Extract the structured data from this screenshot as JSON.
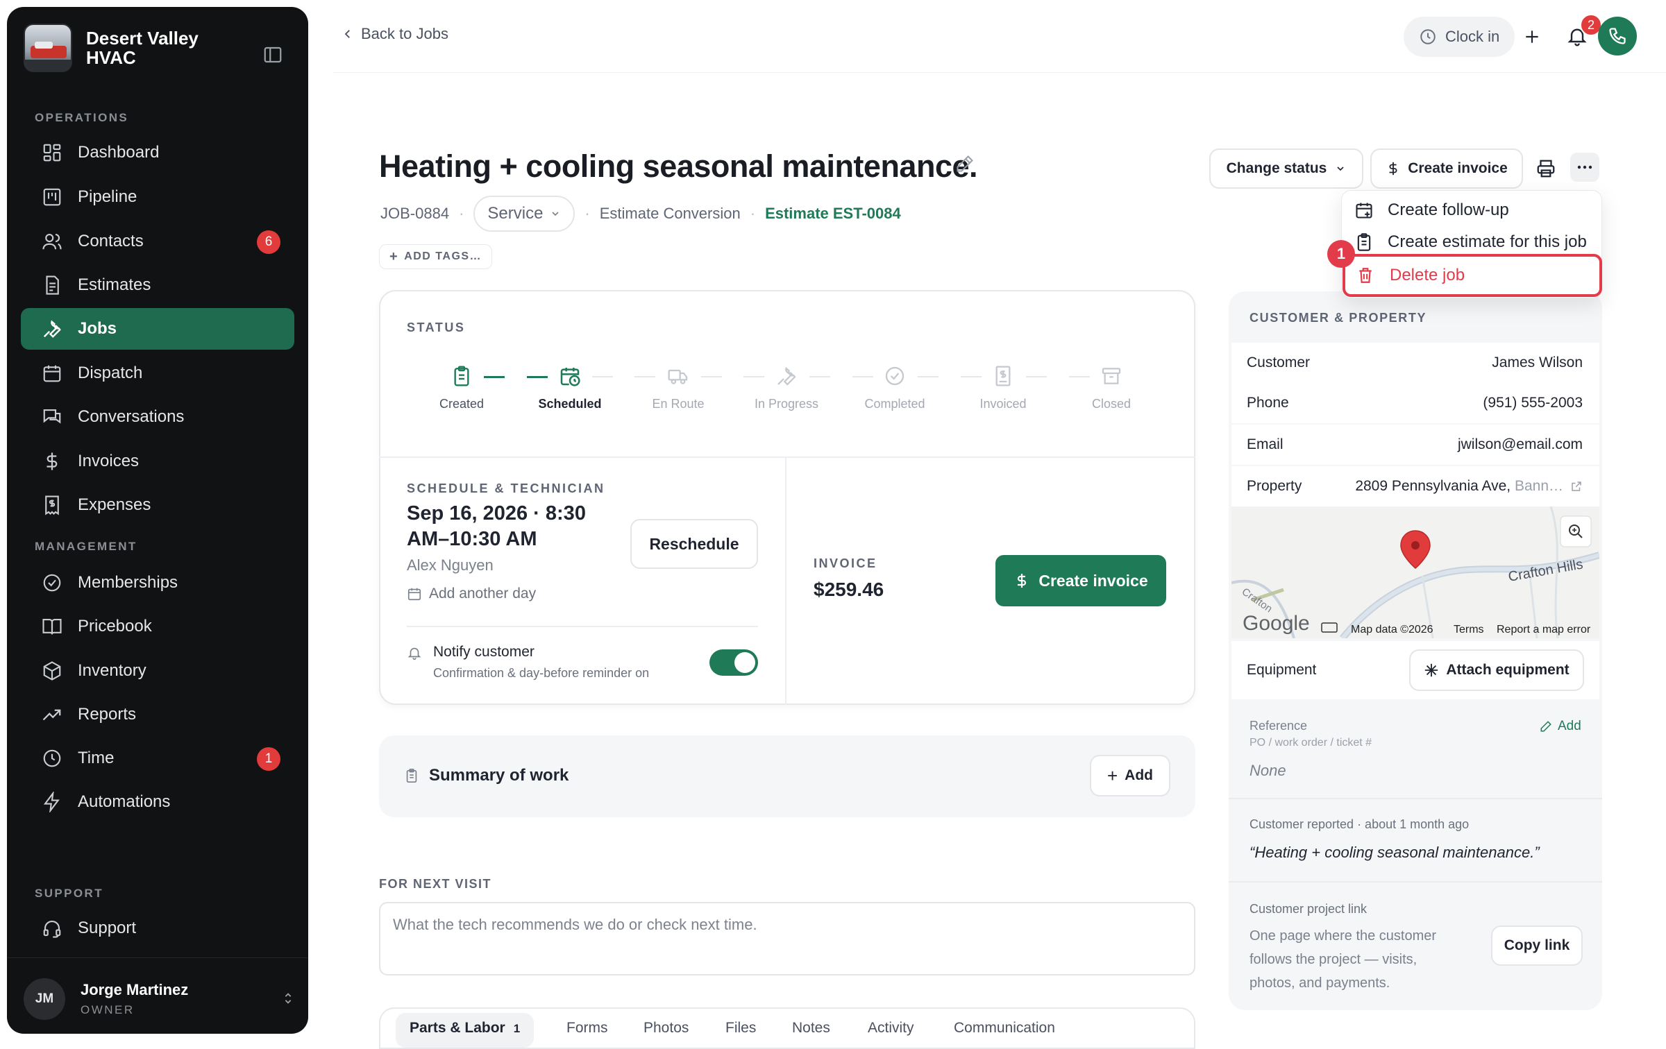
{
  "sidebar": {
    "brand": "Desert Valley HVAC",
    "sections": {
      "operations": "OPERATIONS",
      "management": "MANAGEMENT",
      "support": "SUPPORT"
    },
    "items": [
      {
        "label": "Dashboard",
        "icon": "dashboard-icon"
      },
      {
        "label": "Pipeline",
        "icon": "pipeline-icon"
      },
      {
        "label": "Contacts",
        "icon": "contacts-icon",
        "badge": "6"
      },
      {
        "label": "Estimates",
        "icon": "estimates-icon"
      },
      {
        "label": "Jobs",
        "icon": "wrench-icon",
        "active": true
      },
      {
        "label": "Dispatch",
        "icon": "calendar-icon"
      },
      {
        "label": "Conversations",
        "icon": "chat-icon"
      },
      {
        "label": "Invoices",
        "icon": "dollar-icon"
      },
      {
        "label": "Expenses",
        "icon": "receipt-icon"
      },
      {
        "label": "Memberships",
        "icon": "badge-check-icon"
      },
      {
        "label": "Pricebook",
        "icon": "book-icon"
      },
      {
        "label": "Inventory",
        "icon": "box-icon"
      },
      {
        "label": "Reports",
        "icon": "trend-icon"
      },
      {
        "label": "Time",
        "icon": "clock-icon",
        "badge": "1"
      },
      {
        "label": "Automations",
        "icon": "bolt-icon"
      },
      {
        "label": "Support",
        "icon": "headset-icon"
      }
    ],
    "user": {
      "initials": "JM",
      "name": "Jorge Martinez",
      "role": "OWNER"
    }
  },
  "topbar": {
    "back": "Back to Jobs",
    "clock_in": "Clock in",
    "notifications_count": "2"
  },
  "job": {
    "title": "Heating + cooling seasonal maintenance.",
    "number": "JOB-0884",
    "type": "Service",
    "source": "Estimate Conversion",
    "estimate_link": "Estimate EST-0084",
    "add_tags": "ADD TAGS…",
    "change_status": "Change status",
    "create_invoice": "Create invoice"
  },
  "menu": {
    "follow_up": "Create follow-up",
    "create_estimate": "Create estimate for this job",
    "delete": "Delete job",
    "marker": "1"
  },
  "status": {
    "label": "STATUS",
    "steps": [
      "Created",
      "Scheduled",
      "En Route",
      "In Progress",
      "Completed",
      "Invoiced",
      "Closed"
    ],
    "current_index": 1
  },
  "schedule": {
    "label": "SCHEDULE & TECHNICIAN",
    "date": "Sep 16, 2026 · 8:30 AM–10:30 AM",
    "technician": "Alex Nguyen",
    "add_day": "Add another day",
    "reschedule": "Reschedule",
    "notify_title": "Notify customer",
    "notify_sub": "Confirmation & day-before reminder on",
    "notify_on": true
  },
  "invoice": {
    "label": "INVOICE",
    "amount": "$259.46",
    "button": "Create invoice"
  },
  "summary": {
    "title": "Summary of work",
    "add": "Add"
  },
  "next_visit": {
    "label": "FOR NEXT VISIT",
    "placeholder": "What the tech recommends we do or check next time."
  },
  "tabs": [
    {
      "label": "Parts & Labor",
      "count": "1"
    },
    {
      "label": "Forms"
    },
    {
      "label": "Photos"
    },
    {
      "label": "Files"
    },
    {
      "label": "Notes"
    },
    {
      "label": "Activity"
    },
    {
      "label": "Communication"
    }
  ],
  "customer": {
    "label": "CUSTOMER & PROPERTY",
    "rows": [
      {
        "key": "Customer",
        "value": "James Wilson"
      },
      {
        "key": "Phone",
        "value": "(951) 555-2003"
      },
      {
        "key": "Email",
        "value": "jwilson@email.com"
      },
      {
        "key": "Property",
        "value": "2809 Pennsylvania Ave,",
        "value_muted": "Bann…"
      }
    ],
    "map": {
      "road_1": "Crafton Hills",
      "road_2": "Crafton",
      "provider": "Google",
      "attribution": "Map data ©2026",
      "terms": "Terms",
      "report": "Report a map error"
    },
    "equipment": "Equipment",
    "attach_equipment": "Attach equipment",
    "reference_label": "Reference",
    "reference_sub": "PO / work order / ticket #",
    "reference_value": "None",
    "reference_add": "Add",
    "reported_label": "Customer reported · about 1 month ago",
    "reported_quote": "“Heating + cooling seasonal maintenance.”",
    "project_link_label": "Customer project link",
    "project_link_desc": "One page where the customer follows the project — visits, photos, and payments.",
    "copy_link": "Copy link"
  },
  "colors": {
    "accent": "#1f7a57",
    "danger": "#e23b4a",
    "sidebar_bg": "#111213"
  }
}
